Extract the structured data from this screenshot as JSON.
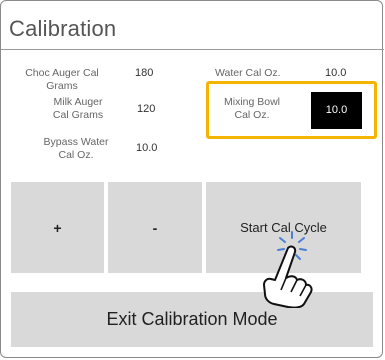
{
  "title": "Calibration",
  "fields": {
    "choc_auger": {
      "label": "Choc Auger Cal Grams",
      "value": "180"
    },
    "water_cal": {
      "label": "Water Cal Oz.",
      "value": "10.0"
    },
    "milk_auger": {
      "label_line1": "Milk Auger",
      "label_line2": "Cal Grams",
      "value": "120"
    },
    "mixing_bowl": {
      "label_line1": "Mixing Bowl",
      "label_line2": "Cal Oz.",
      "value": "10.0"
    },
    "bypass_water": {
      "label_line1": "Bypass Water",
      "label_line2": "Cal Oz.",
      "value": "10.0"
    }
  },
  "buttons": {
    "plus": "+",
    "minus": "-",
    "start": "Start Cal Cycle",
    "exit": "Exit Calibration Mode"
  },
  "colors": {
    "highlight": "#f5b400",
    "button_bg": "#d9d9d9",
    "field_active": "#000000"
  },
  "icons": {
    "pointer": "tapping-hand-icon"
  }
}
